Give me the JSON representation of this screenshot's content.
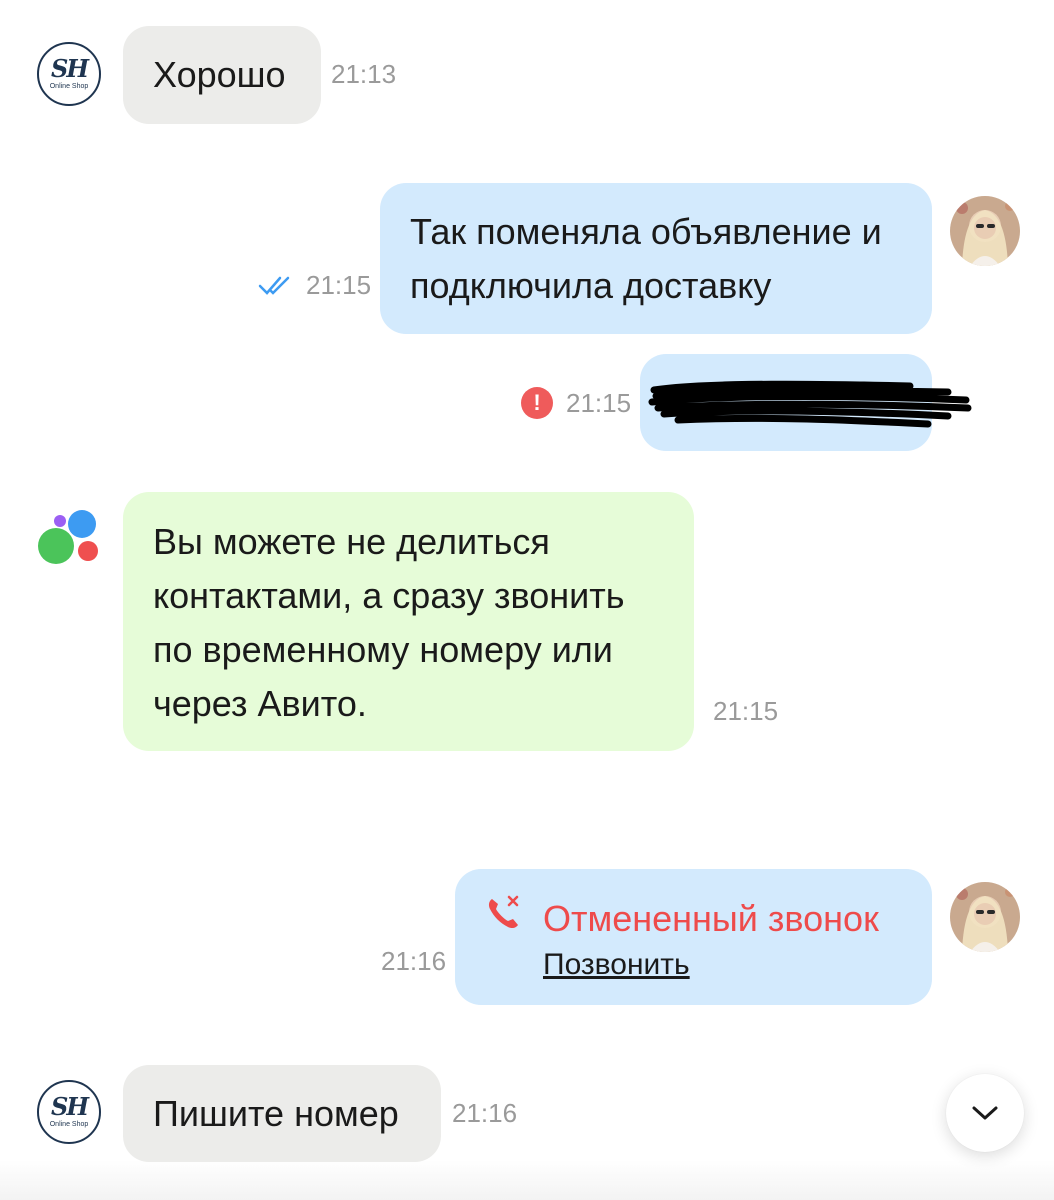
{
  "messages": [
    {
      "text": "Хорошо",
      "time": "21:13"
    },
    {
      "text_line1": "Так поменяла объявление и",
      "text_line2": "подключила доставку",
      "time": "21:15"
    },
    {
      "time": "21:15"
    },
    {
      "lines": [
        "Вы можете не делиться",
        "контактами, а сразу звонить",
        "по временному номеру или",
        "через Авито."
      ],
      "time": "21:15"
    },
    {
      "call_title": "Отмененный звонок",
      "call_action": "Позвонить",
      "time": "21:16"
    },
    {
      "text": "Пишите номер",
      "time": "21:16"
    }
  ],
  "shop_avatar": {
    "monogram": "SH",
    "caption": "Online Shop"
  },
  "icons": {
    "read_receipt": "double-check-icon",
    "error": "error-icon",
    "missed_call": "phone-missed-icon",
    "scroll_down": "chevron-down-icon"
  },
  "colors": {
    "incoming_bubble": "#ececea",
    "outgoing_bubble": "#d3eafd",
    "system_bubble": "#e6fcd8",
    "error": "#ef5b5b",
    "read_check": "#3d9bf2",
    "missed_call": "#ee4b4b"
  }
}
